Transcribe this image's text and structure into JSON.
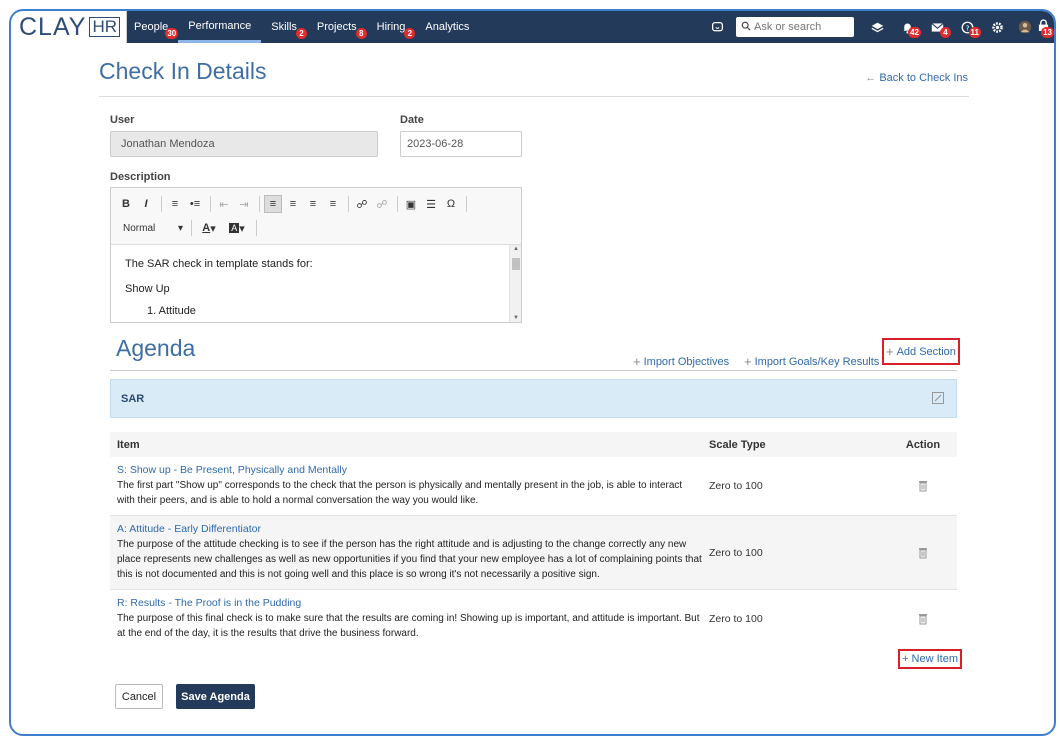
{
  "logo": {
    "clay": "CLAY",
    "hr": "HR"
  },
  "nav": [
    {
      "label": "People",
      "badge": "30"
    },
    {
      "label": "Performance",
      "badge": ""
    },
    {
      "label": "Skills",
      "badge": "2"
    },
    {
      "label": "Projects",
      "badge": "8"
    },
    {
      "label": "Hiring",
      "badge": "2"
    },
    {
      "label": "Analytics",
      "badge": ""
    }
  ],
  "search": {
    "placeholder": "Ask or search"
  },
  "topbar_badges": {
    "bell": "42",
    "mail": "4",
    "help": "11",
    "avatar": "13"
  },
  "page": {
    "title": "Check In Details",
    "back_link": "Back to Check Ins"
  },
  "form": {
    "user_label": "User",
    "user_value": "Jonathan Mendoza",
    "date_label": "Date",
    "date_value": "2023-06-28",
    "description_label": "Description",
    "format_select": "Normal",
    "description_lines": [
      "The SAR check in template stands for:",
      "Show Up",
      "1. Attitude"
    ]
  },
  "agenda": {
    "title": "Agenda",
    "import_objectives": "Import Objectives",
    "import_goals": "Import Goals/Key Results",
    "add_section": "Add Section",
    "section_name": "SAR",
    "columns": {
      "item": "Item",
      "scale": "Scale Type",
      "action": "Action"
    },
    "rows": [
      {
        "title": "S: Show up - Be Present, Physically and Mentally",
        "description": "The first part \"Show up\" corresponds to the check that the person is physically and mentally present in the job, is able to interact with their peers, and is able to hold a normal conversation the way you would like.",
        "scale": "Zero to 100"
      },
      {
        "title": "A: Attitude - Early Differentiator",
        "description": "The purpose of the attitude checking is to see if the person has the right attitude and is adjusting to the change correctly any new place represents new challenges as well as new opportunities if you find that your new employee has a lot of complaining points that this is not documented and this is not going well and this place is so wrong  it's not necessarily a positive sign.",
        "scale": "Zero to 100"
      },
      {
        "title": "R: Results - The Proof is in the Pudding",
        "description": "The purpose of this final check is to make sure that the results are coming in!  Showing up is important, and attitude is important.  But at the end of the day, it is the results that drive the business forward.",
        "scale": "Zero to 100"
      }
    ],
    "new_item": "+ New Item"
  },
  "buttons": {
    "cancel": "Cancel",
    "save": "Save Agenda"
  },
  "colors": {
    "topbar": "#243a5a",
    "accent": "#2f6aad",
    "highlight": "#d8202a",
    "section_bg": "#d9ebf7"
  }
}
